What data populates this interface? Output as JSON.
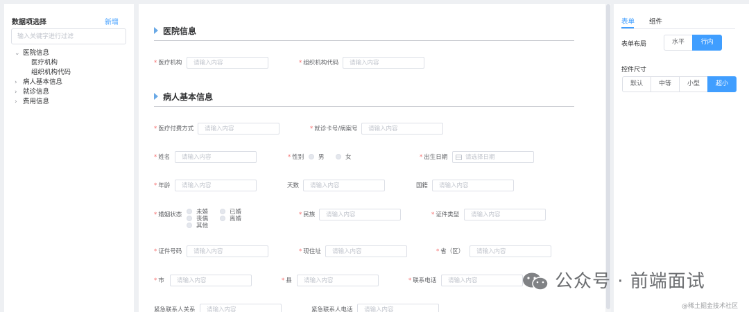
{
  "left_panel": {
    "title": "数据项选择",
    "add_label": "新增",
    "search_placeholder": "输入关键字进行过滤",
    "tree": [
      {
        "label": "医院信息",
        "arrow": "⌄",
        "level": 0
      },
      {
        "label": "医疗机构",
        "arrow": "",
        "level": 1
      },
      {
        "label": "组织机构代码",
        "arrow": "",
        "level": 1
      },
      {
        "label": "病人基本信息",
        "arrow": "›",
        "level": 0
      },
      {
        "label": "就诊信息",
        "arrow": "›",
        "level": 0
      },
      {
        "label": "费用信息",
        "arrow": "›",
        "level": 0
      }
    ]
  },
  "sections": [
    {
      "title": "医院信息"
    },
    {
      "title": "病人基本信息"
    }
  ],
  "fields": {
    "org": {
      "label": "医疗机构",
      "required": "*",
      "placeholder": "请输入内容"
    },
    "org_code": {
      "label": "组织机构代码",
      "required": "*",
      "placeholder": "请输入内容"
    },
    "payment": {
      "label": "医疗付费方式",
      "required": "*",
      "placeholder": "请输入内容"
    },
    "card_no": {
      "label": "就诊卡号/病案号",
      "required": "*",
      "placeholder": "请输入内容"
    },
    "name": {
      "label": "姓名",
      "required": "*",
      "placeholder": "请输入内容"
    },
    "gender": {
      "label": "性别",
      "required": "*",
      "options": [
        "男",
        "女"
      ]
    },
    "birth": {
      "label": "出生日期",
      "required": "*",
      "placeholder": "请选择日期"
    },
    "age": {
      "label": "年龄",
      "required": "*",
      "placeholder": "请输入内容"
    },
    "days": {
      "label": "天数",
      "placeholder": "请输入内容"
    },
    "nationality": {
      "label": "国籍",
      "placeholder": "请输入内容"
    },
    "marital": {
      "label": "婚姻状态",
      "required": "*",
      "options": [
        "未婚",
        "已婚",
        "丧偶",
        "离婚",
        "其他"
      ]
    },
    "ethnic": {
      "label": "民族",
      "required": "*",
      "placeholder": "请输入内容"
    },
    "id_type": {
      "label": "证件类型",
      "required": "*",
      "placeholder": "请输入内容"
    },
    "id_no": {
      "label": "证件号码",
      "required": "*",
      "placeholder": "请输入内容"
    },
    "address": {
      "label": "现住址",
      "required": "*",
      "placeholder": "请输入内容"
    },
    "province": {
      "label": "省（区）",
      "required": "*",
      "placeholder": "请输入内容"
    },
    "city": {
      "label": "市",
      "required": "*",
      "placeholder": "请输入内容"
    },
    "county": {
      "label": "县",
      "required": "*",
      "placeholder": "请输入内容"
    },
    "phone": {
      "label": "联系电话",
      "required": "*",
      "placeholder": "请输入内容"
    },
    "emerg_relation": {
      "label": "紧急联系人关系",
      "placeholder": "请输入内容"
    },
    "emerg_phone": {
      "label": "紧急联系人电话",
      "placeholder": "请输入内容"
    }
  },
  "right_panel": {
    "tabs": [
      "表单",
      "组件"
    ],
    "active_tab": "表单",
    "layout_label": "表单布局",
    "layout_options": [
      "水平",
      "行内"
    ],
    "layout_selected": "行内",
    "size_label": "控件尺寸",
    "size_options": [
      "默认",
      "中等",
      "小型",
      "超小"
    ],
    "size_selected": "超小"
  },
  "watermark": {
    "text": "公众号 · 前端面试",
    "sub": "@稀土掘金技术社区"
  },
  "colors": {
    "accent": "#409eff",
    "required": "#f56c6c",
    "section_marker": "#6aa9e6"
  }
}
